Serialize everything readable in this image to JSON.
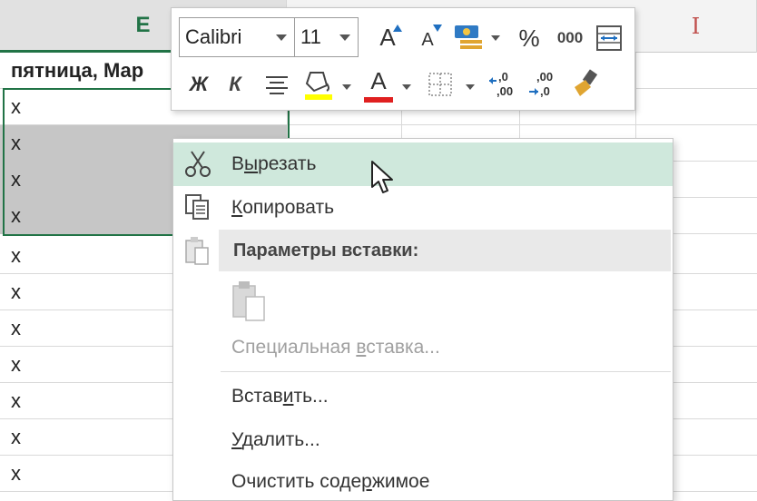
{
  "sheet": {
    "columns": {
      "e": "E",
      "i": "I"
    },
    "header_cell": "пятница, Мар",
    "cells": [
      "x",
      "x",
      "x",
      "x",
      "x",
      "x",
      "x",
      "x",
      "x",
      "x",
      "x"
    ]
  },
  "mini_toolbar": {
    "font_name": "Calibri",
    "font_size": "11",
    "grow_font": "A",
    "shrink_font": "A",
    "percent": "%",
    "thousands": "000",
    "bold": "Ж",
    "italic": "К",
    "font_color_letter": "A",
    "increase_decimal": ".0",
    "decrease_decimal": ".00",
    "colors": {
      "highlight": "#ffff00",
      "font": "#e02020"
    }
  },
  "context_menu": {
    "cut": {
      "pre": "В",
      "key": "ы",
      "post": "резать"
    },
    "copy": {
      "pre": "",
      "key": "К",
      "post": "опировать"
    },
    "paste_options": "Параметры вставки:",
    "paste_special": {
      "pre": "Специальная ",
      "key": "в",
      "post": "ставка..."
    },
    "insert": {
      "pre": "Встав",
      "key": "и",
      "post": "ть..."
    },
    "delete": {
      "pre": "",
      "key": "У",
      "post": "далить..."
    },
    "clear": {
      "pre": "Очистить соде",
      "key": "р",
      "post": "жимое"
    }
  }
}
